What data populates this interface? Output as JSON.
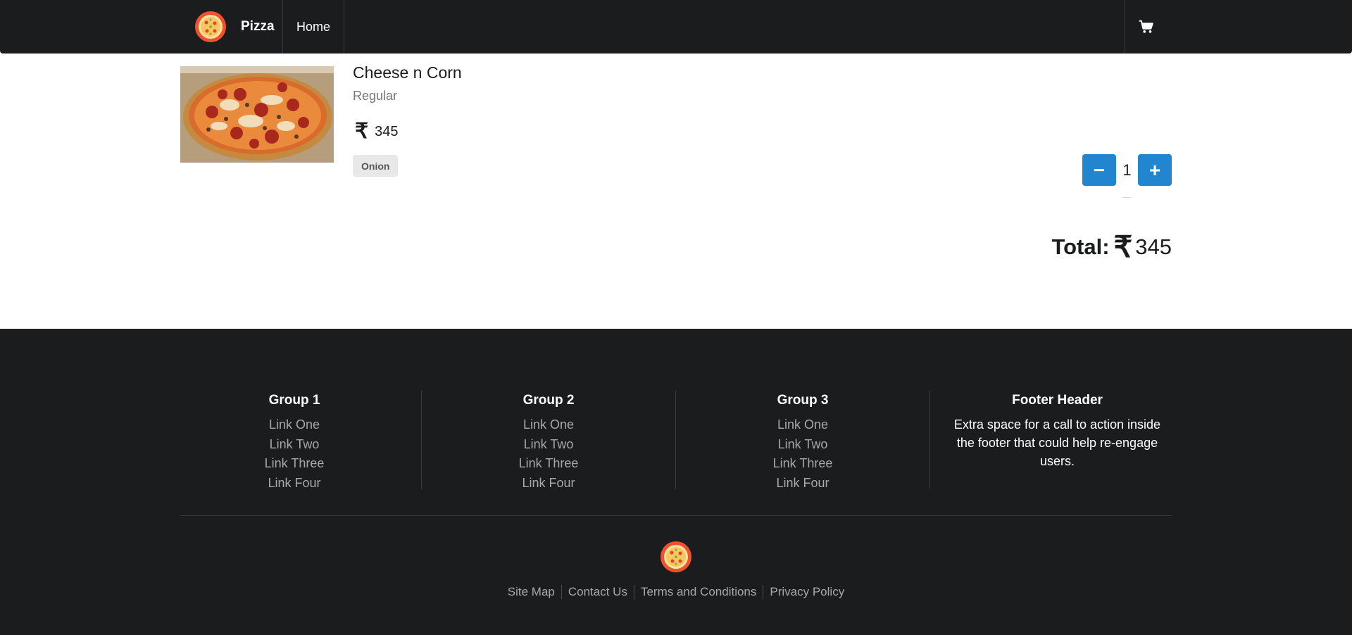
{
  "navbar": {
    "brand": "Pizza",
    "home": "Home",
    "cart_icon": "shopping-cart-icon",
    "logo_icon": "pizza-logo-icon"
  },
  "cart": {
    "item": {
      "name": "Cheese n Corn",
      "size": "Regular",
      "currency_symbol": "₹",
      "price": "345",
      "topping": "Onion",
      "quantity": "1"
    },
    "decrement_label": "−",
    "increment_label": "+",
    "total_label": "Total:",
    "total_currency": "₹",
    "total_value": "345"
  },
  "footer": {
    "groups": [
      {
        "title": "Group 1",
        "links": [
          "Link One",
          "Link Two",
          "Link Three",
          "Link Four"
        ]
      },
      {
        "title": "Group 2",
        "links": [
          "Link One",
          "Link Two",
          "Link Three",
          "Link Four"
        ]
      },
      {
        "title": "Group 3",
        "links": [
          "Link One",
          "Link Two",
          "Link Three",
          "Link Four"
        ]
      }
    ],
    "cta": {
      "title": "Footer Header",
      "text": "Extra space for a call to action inside the footer that could help re-engage users."
    },
    "bottom_links": [
      "Site Map",
      "Contact Us",
      "Terms and Conditions",
      "Privacy Policy"
    ]
  },
  "colors": {
    "dark": "#1b1c1d",
    "primary_blue": "#2185d0",
    "pizza_orange": "#f0522d"
  }
}
